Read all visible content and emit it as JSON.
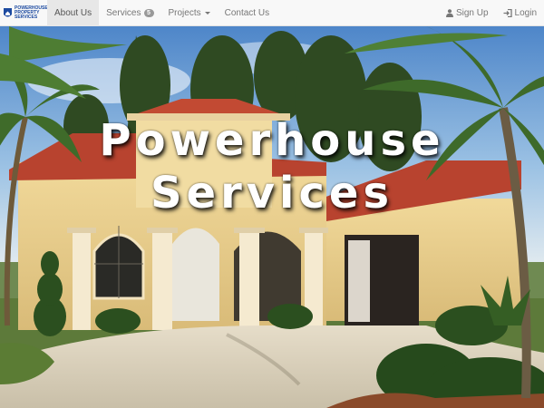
{
  "brand": {
    "logo_lines": [
      "POWERHOUSE",
      "PROPERTY",
      "SERVICES"
    ]
  },
  "nav": {
    "items": [
      {
        "label": "About Us",
        "active": true
      },
      {
        "label": "Services",
        "badge": "5"
      },
      {
        "label": "Projects"
      },
      {
        "label": "Contact Us"
      }
    ],
    "signup_label": "Sign Up",
    "login_label": "Login"
  },
  "hero": {
    "title_line1": "Powerhouse",
    "title_line2": "Services"
  },
  "colors": {
    "navbar_bg": "#f8f8f8",
    "active_tab_bg": "#e7e7e7",
    "brand_blue": "#1c4aa0",
    "hero_text": "#ffffff"
  }
}
